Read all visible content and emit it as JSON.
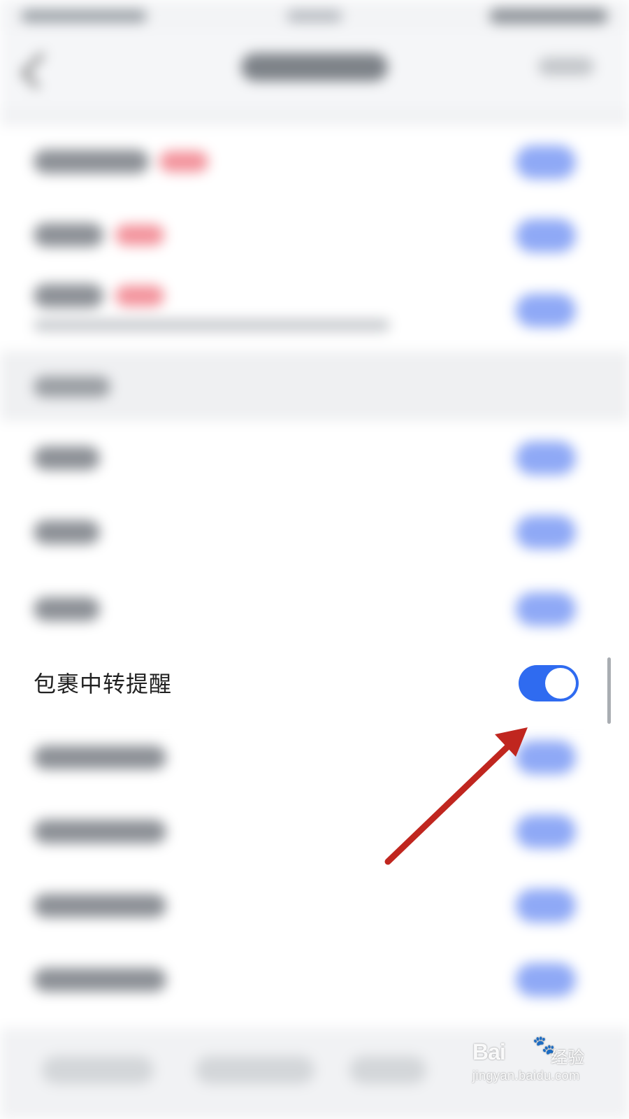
{
  "setting_row": {
    "label": "包裹中转提醒",
    "toggle_on": true
  },
  "watermark": {
    "brand": "Bai",
    "brand_icon": "paw-icon",
    "brand_suffix": "经验",
    "url": "jingyan.baidu.com"
  },
  "colors": {
    "toggle_on": "#2f6bf0",
    "arrow": "#c0261f",
    "badge": "#f3939c"
  }
}
